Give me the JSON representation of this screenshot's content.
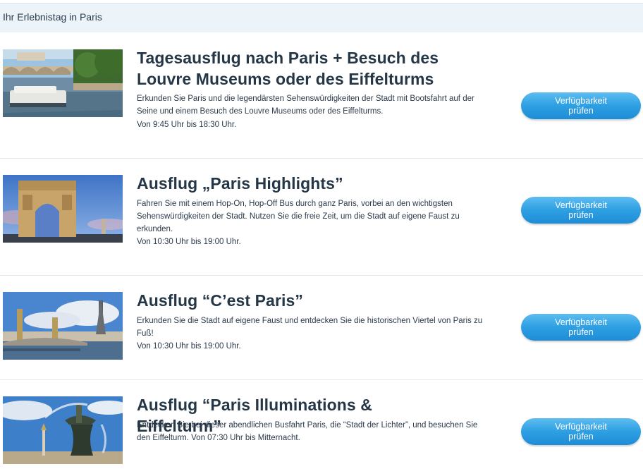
{
  "header": {
    "title": "Ihr Erlebnistag in Paris"
  },
  "tours": [
    {
      "title": "Tagesausflug nach Paris + Besuch des Louvre Museums oder des Eiffelturms",
      "desc": "Erkunden Sie Paris und die legendärsten Sehenswürdigkeiten der Stadt mit Bootsfahrt auf der Seine und einem Besuch des Louvre Museums oder des Eiffelturms.",
      "time": "Von 9:45 Uhr bis 18:30 Uhr.",
      "button": "Verfügbarkeit prüfen"
    },
    {
      "title": "Ausflug „Paris Highlights”",
      "desc": "Fahren Sie mit einem Hop-On, Hop-Off Bus durch ganz Paris, vorbei an den wichtigsten Sehenswürdigkeiten der Stadt. Nutzen Sie die freie Zeit, um die Stadt auf eigene Faust zu erkunden.",
      "time": "Von 10:30 Uhr bis 19:00 Uhr.",
      "button": "Verfügbarkeit prüfen"
    },
    {
      "title": "Ausflug “C’est Paris”",
      "desc": "Erkunden Sie die Stadt auf eigene Faust und entdecken Sie die historischen Viertel von Paris zu Fuß!",
      "time": "Von 10:30 Uhr bis 19:00 Uhr.",
      "button": "Verfügbarkeit prüfen"
    },
    {
      "title": "Ausflug “Paris Illuminations & Eiffelturm”",
      "desc": "Entdecken Sie bei dieser abendlichen Busfahrt Paris, die “Stadt der Lichter”, und besuchen Sie den Eiffelturm. Von 07:30 Uhr bis Mitternacht.",
      "time": "",
      "button": "Verfügbarkeit prüfen"
    }
  ]
}
